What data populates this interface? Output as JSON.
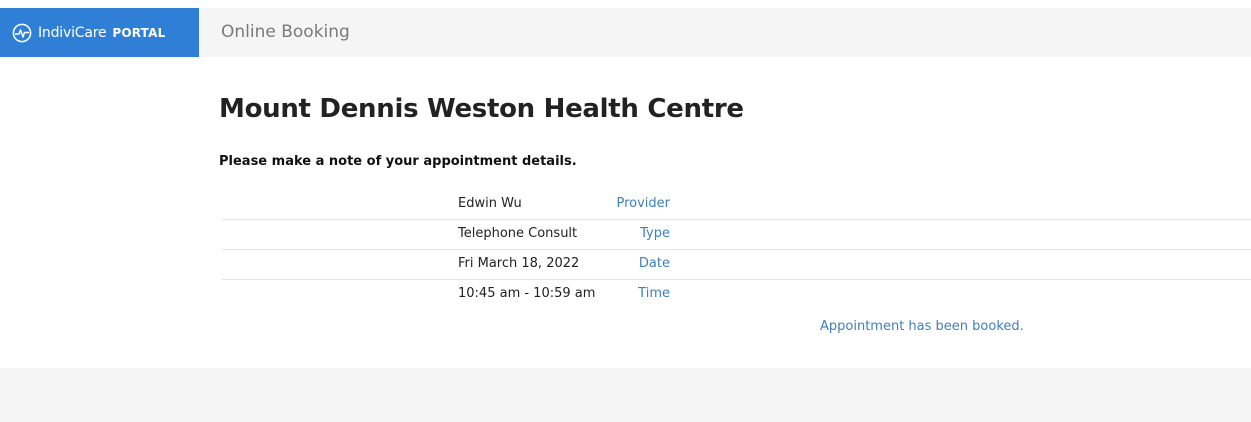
{
  "navbar": {
    "brand_name": "IndiviCare",
    "brand_suffix": "PORTAL",
    "logo_icon": "heartbeat-circle-icon",
    "brand_color": "#2f7fd6",
    "nav_link": "Online Booking"
  },
  "page": {
    "title": "Mount Dennis Weston Health Centre",
    "note": "Please make a note of your appointment details."
  },
  "appointment": [
    {
      "label": "Provider",
      "value": "Edwin Wu"
    },
    {
      "label": "Type",
      "value": "Telephone Consult"
    },
    {
      "label": "Date",
      "value": "Fri March 18, 2022"
    },
    {
      "label": "Time",
      "value": "10:45 am - 10:59 am"
    }
  ],
  "status": {
    "message": "Appointment has been booked."
  }
}
